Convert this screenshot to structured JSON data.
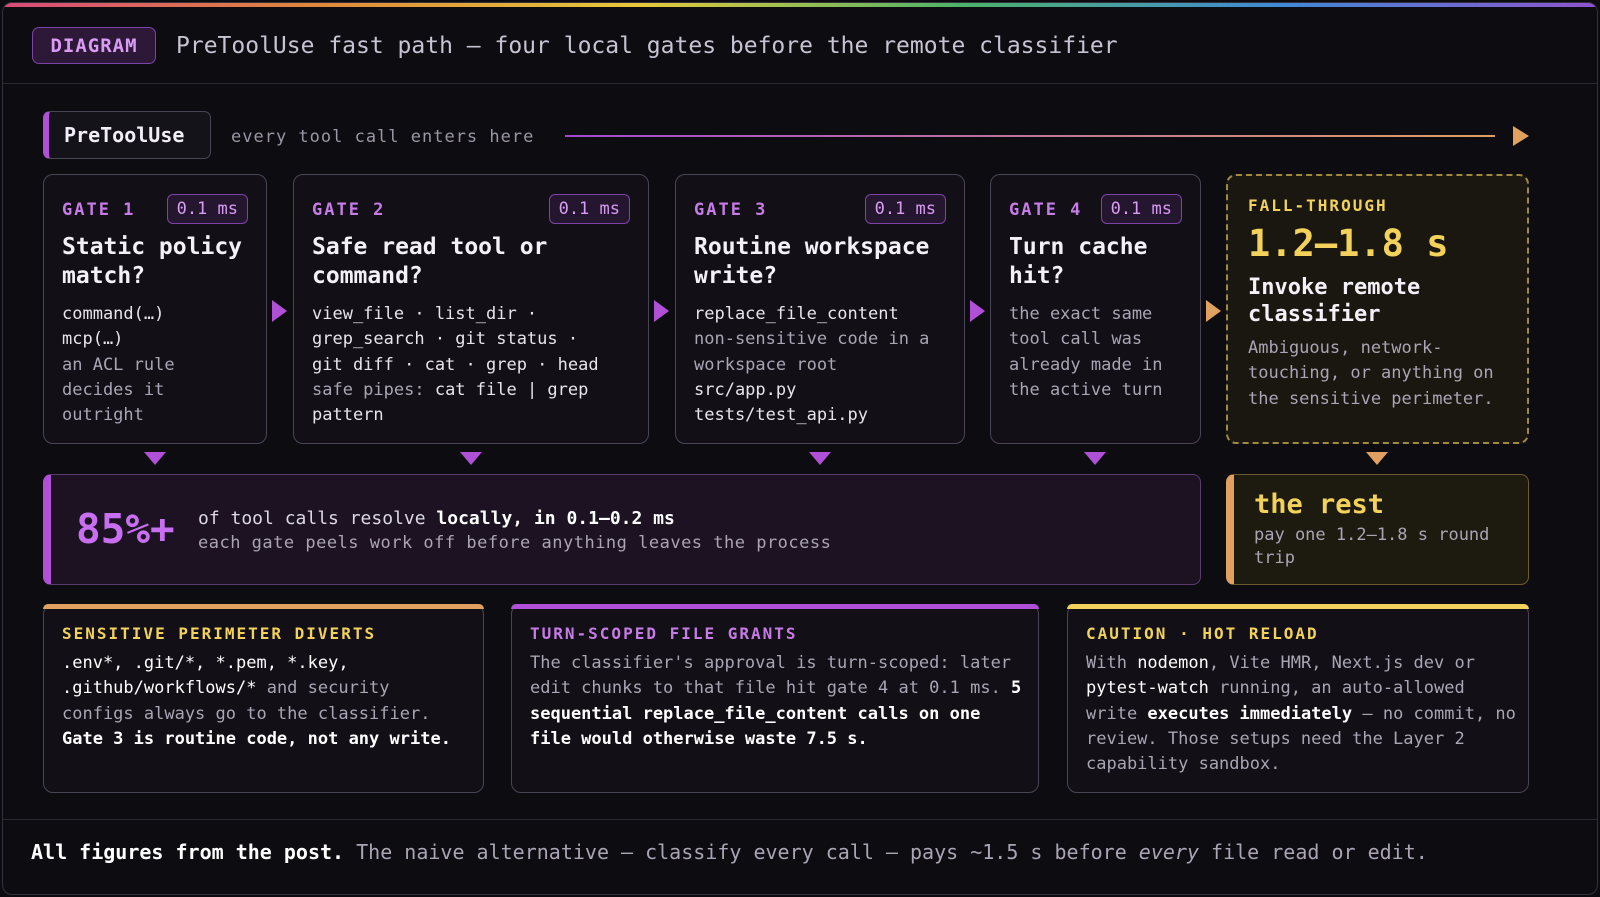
{
  "header": {
    "badge": "DIAGRAM",
    "title": "PreToolUse fast path — four local gates before the remote classifier"
  },
  "entry": {
    "label": "PreToolUse",
    "note": "every tool call enters here"
  },
  "gates": [
    {
      "label": "GATE 1",
      "time": "0.1 ms",
      "title": "Static policy match?",
      "lines": [
        "command(…)",
        "mcp(…)",
        "an ACL rule",
        "decides it",
        "outright"
      ]
    },
    {
      "label": "GATE 2",
      "time": "0.1 ms",
      "title": "Safe read tool or command?",
      "lines": [
        "view_file · list_dir ·",
        "grep_search · git status ·",
        "git diff · cat · grep · head"
      ],
      "pipe_prefix": "safe pipes: ",
      "pipe_code": "cat file | grep",
      "pipe_cont": "pattern"
    },
    {
      "label": "GATE 3",
      "time": "0.1 ms",
      "title": "Routine workspace write?",
      "lines": [
        "replace_file_content",
        "non-sensitive code in a",
        "workspace root",
        "src/app.py",
        "tests/test_api.py"
      ]
    },
    {
      "label": "GATE 4",
      "time": "0.1 ms",
      "title": "Turn cache hit?",
      "lines": [
        "the exact same",
        "tool call was",
        "already made in",
        "the active turn"
      ]
    }
  ],
  "fallthrough": {
    "label": "FALL-THROUGH",
    "big": "1.2–1.8 s",
    "title": "Invoke remote classifier",
    "body": "Ambiguous, network-touching, or anything on the sensitive perimeter."
  },
  "summary": {
    "pct": "85%+",
    "line1_a": "of tool calls resolve ",
    "line1_b": "locally, in 0.1–0.2 ms",
    "line2": "each gate peels work off before anything leaves the process"
  },
  "rest": {
    "title": "the rest",
    "body": "pay one 1.2–1.8 s round trip"
  },
  "notes": {
    "sensitive": {
      "label": "SENSITIVE PERIMETER DIVERTS",
      "code": ".env*, .git/*, *.pem, *.key, .github/workflows/*",
      "text": " and security configs always go to the classifier. ",
      "bold": "Gate 3 is routine code, not any write."
    },
    "grants": {
      "label": "TURN-SCOPED FILE GRANTS",
      "text": "The classifier's approval is turn-scoped: later edit chunks to that file hit gate 4 at 0.1 ms. ",
      "bold": "5 sequential replace_file_content calls on one file would otherwise waste 7.5 s."
    },
    "caution": {
      "label": "CAUTION · HOT RELOAD",
      "t1": "With ",
      "c1": "nodemon",
      "t2": ", Vite HMR, Next.js dev or ",
      "c2": "pytest-watch",
      "t3": " running, an auto-allowed write ",
      "b1": "executes immediately",
      "t4": " — no commit, no review. Those setups need the Layer 2 capability sandbox."
    }
  },
  "footer": {
    "bold": "All figures from the post.",
    "text1": " The naive alternative — classify every call — pays ~1.5 s before ",
    "em": "every",
    "text2": " file read or edit."
  },
  "colors": {
    "accent_purple": "#b050d6",
    "accent_orange": "#e0a060",
    "accent_yellow": "#f2d25a"
  }
}
